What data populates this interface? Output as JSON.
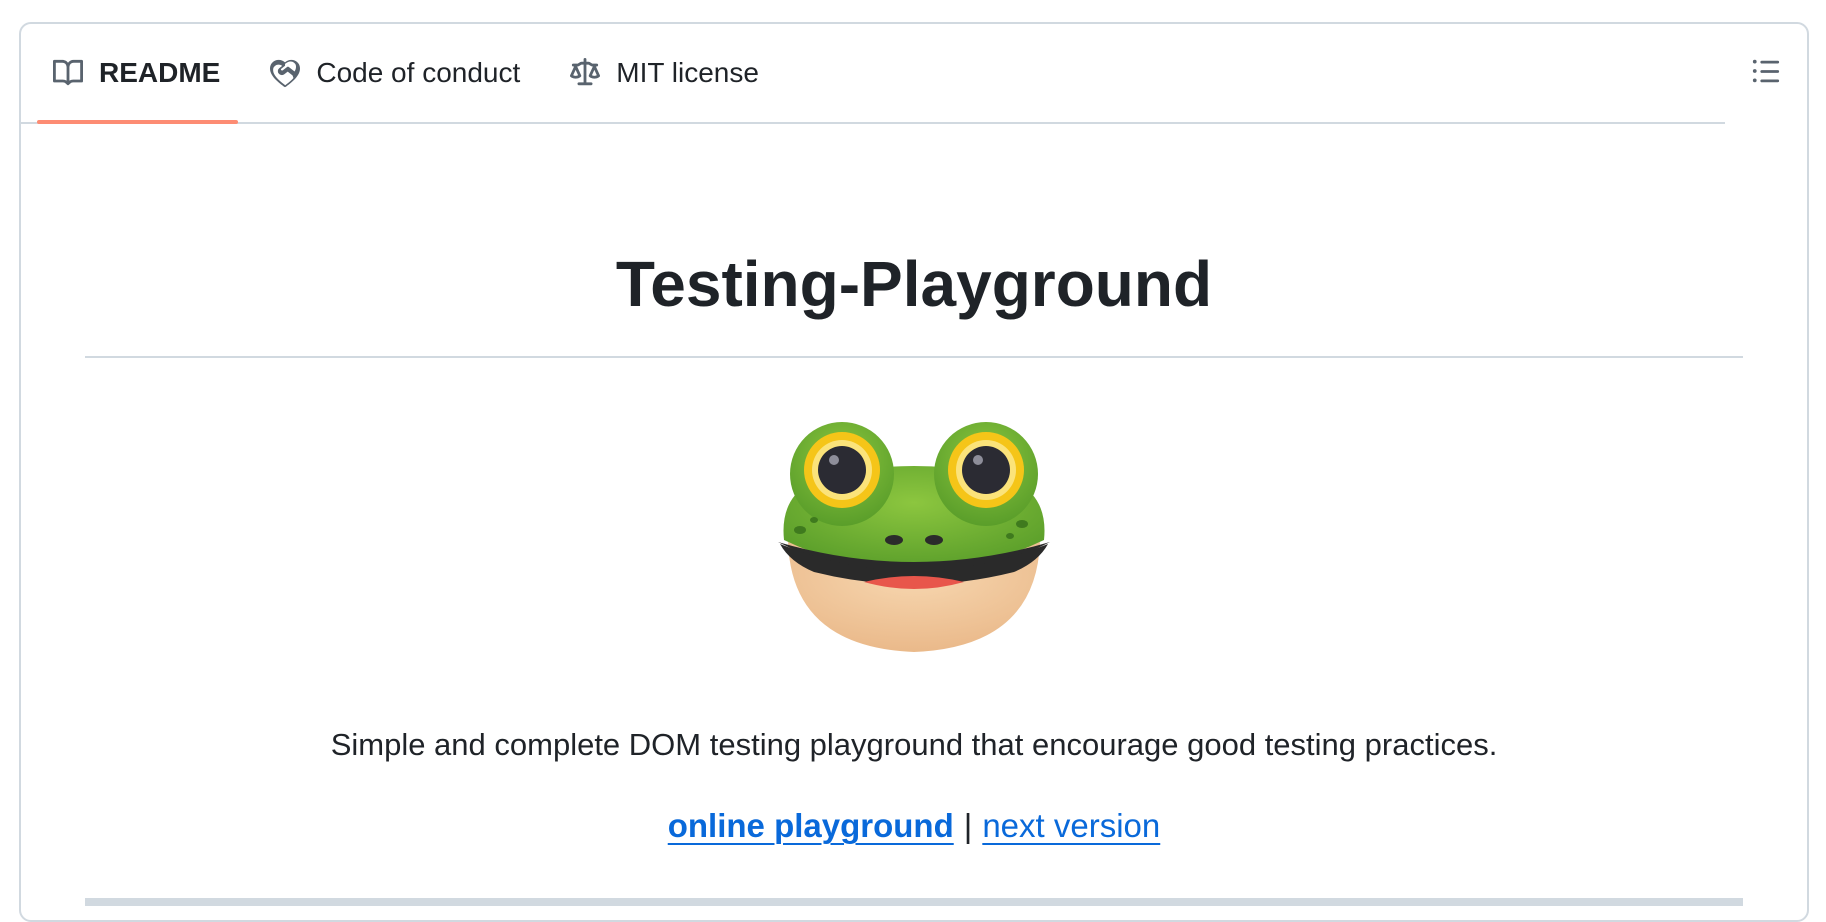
{
  "tabs": [
    {
      "label": "README",
      "icon": "book-icon",
      "active": true
    },
    {
      "label": "Code of conduct",
      "icon": "code-of-conduct-icon",
      "active": false
    },
    {
      "label": "MIT license",
      "icon": "law-icon",
      "active": false
    }
  ],
  "outline_button": {
    "icon": "list-unordered-icon"
  },
  "readme": {
    "title": "Testing-Playground",
    "logo": "frog-icon",
    "tagline": "Simple and complete DOM testing playground that encourage good testing practices.",
    "links": [
      {
        "label": "online playground",
        "bold": true
      },
      {
        "label": "next version",
        "bold": false
      }
    ],
    "separator": "|"
  },
  "colors": {
    "active_tab_underline": "#fd8c73",
    "link": "#0969da",
    "border": "#d1d9e0",
    "text": "#1f2328"
  }
}
